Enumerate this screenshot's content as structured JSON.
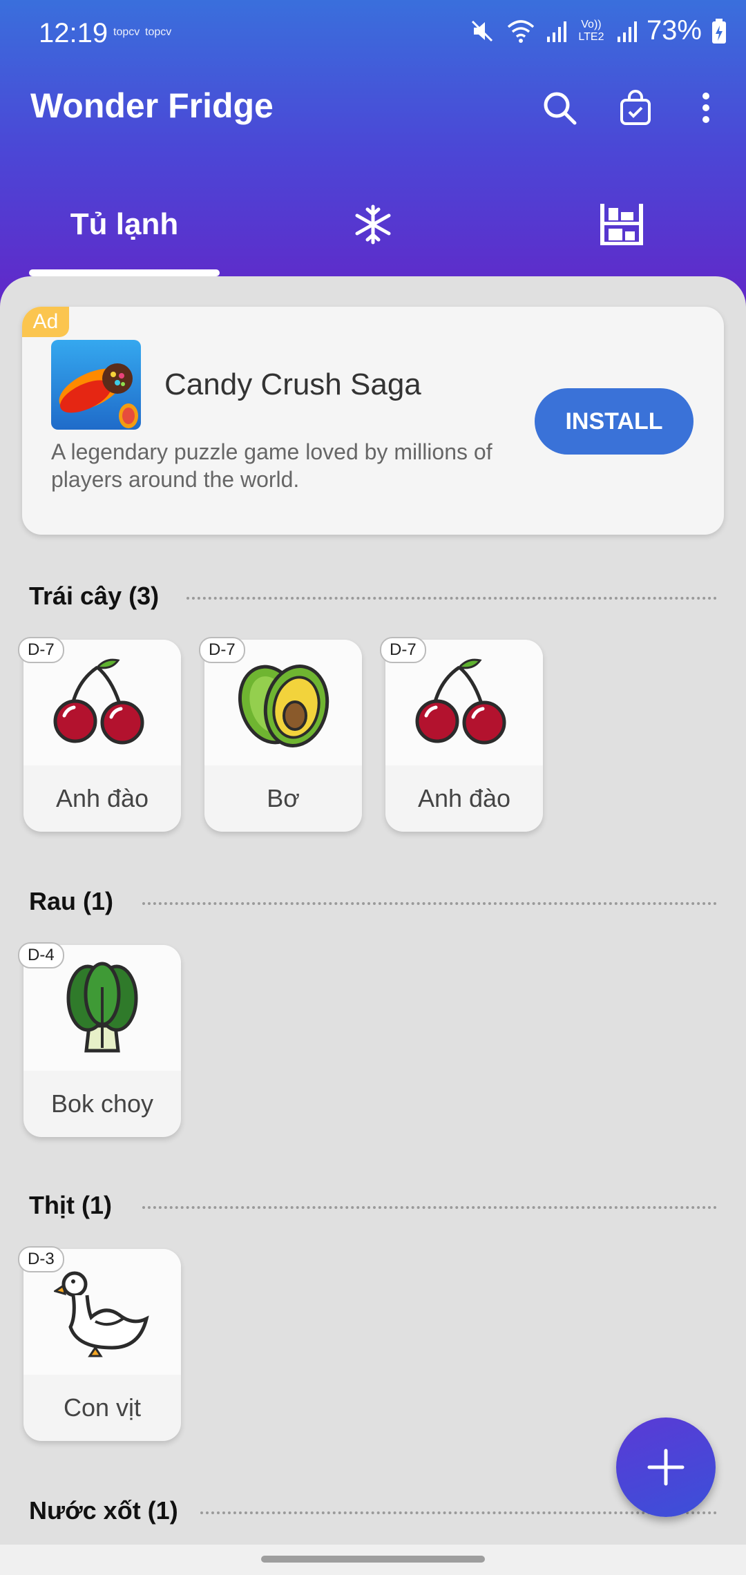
{
  "status_bar": {
    "time": "12:19",
    "notif_1": "topcv",
    "notif_2": "topcv",
    "volte": "Vo)) LTE2",
    "battery": "73%",
    "icons": [
      "mute-icon",
      "wifi-icon",
      "signal-icon",
      "signal-icon",
      "battery-icon"
    ]
  },
  "app_bar": {
    "title": "Wonder Fridge",
    "actions": [
      "search-icon",
      "shopping-bag-icon",
      "more-vert-icon"
    ]
  },
  "tabs": [
    {
      "label": "Tủ lạnh",
      "selected": true
    },
    {
      "icon": "snowflake-icon"
    },
    {
      "icon": "pantry-shelf-icon"
    }
  ],
  "ad": {
    "badge": "Ad",
    "title": "Candy Crush Saga",
    "description": "A legendary puzzle game loved by millions of players around the world.",
    "button": "INSTALL"
  },
  "sections": [
    {
      "title": "Trái cây (3)",
      "items": [
        {
          "badge": "D-7",
          "label": "Anh đào",
          "icon": "cherry-icon"
        },
        {
          "badge": "D-7",
          "label": "Bơ",
          "icon": "avocado-icon"
        },
        {
          "badge": "D-7",
          "label": "Anh đào",
          "icon": "cherry-icon"
        }
      ]
    },
    {
      "title": "Rau (1)",
      "items": [
        {
          "badge": "D-4",
          "label": "Bok choy",
          "icon": "bok-choy-icon"
        }
      ]
    },
    {
      "title": "Thịt (1)",
      "items": [
        {
          "badge": "D-3",
          "label": "Con vịt",
          "icon": "duck-icon"
        }
      ]
    },
    {
      "title": "Nước xốt (1)",
      "items": []
    }
  ],
  "colors": {
    "header_top": "#3a6fdc",
    "header_bottom": "#6522c6",
    "accent": "#3a72d8",
    "ad_badge": "#fbc54f"
  }
}
